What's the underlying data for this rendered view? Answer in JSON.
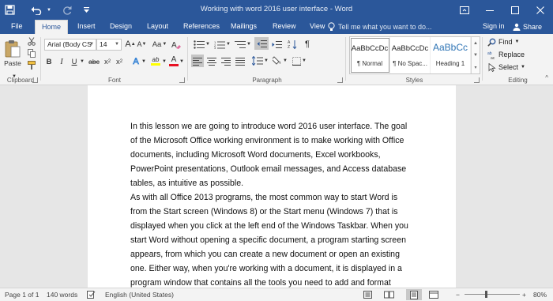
{
  "window": {
    "title": "Working with word 2016 user interface - Word"
  },
  "tabs": [
    "File",
    "Home",
    "Insert",
    "Design",
    "Layout",
    "References",
    "Mailings",
    "Review",
    "View"
  ],
  "active_tab": "Home",
  "tell_me": "Tell me what you want to do...",
  "account": {
    "signin": "Sign in",
    "share": "Share"
  },
  "ribbon": {
    "clipboard": {
      "label": "Clipboard",
      "paste": "Paste"
    },
    "font": {
      "label": "Font",
      "font_name": "Arial (Body CS",
      "font_size": "14",
      "grow_glyph": "A",
      "shrink_glyph": "A",
      "case_glyph": "Aa",
      "bold": "B",
      "italic": "I",
      "underline": "U",
      "strike": "abc",
      "subscript": "x",
      "subscript_mark": "2",
      "superscript": "x",
      "superscript_mark": "2",
      "effects_glyph": "A",
      "highlight_glyph": "ab",
      "color_glyph": "A",
      "highlight_color": "#ffff00",
      "font_color": "#e81123"
    },
    "paragraph": {
      "label": "Paragraph",
      "pilcrow": "¶"
    },
    "styles": {
      "label": "Styles",
      "items": [
        {
          "sample": "AaBbCcDc",
          "name": "¶ Normal"
        },
        {
          "sample": "AaBbCcDc",
          "name": "¶ No Spac..."
        },
        {
          "sample": "AaBbCc",
          "name": "Heading 1"
        }
      ]
    },
    "editing": {
      "label": "Editing",
      "find": "Find",
      "replace": "Replace",
      "select": "Select"
    }
  },
  "document": {
    "paragraphs": [
      "In this lesson we are going to introduce word 2016 user interface. The goal of the Microsoft Office working environment is to make working with Office documents, including Microsoft Word documents, Excel workbooks, PowerPoint presentations, Outlook email messages, and Access database tables, as intuitive as possible.",
      "As with all Office 2013 programs, the most common way to start Word is from the Start screen (Windows 8) or the Start menu (Windows 7) that is displayed when you click at the left end of the Windows Taskbar. When you start Word without opening a specific document, a program starting screen appears, from which you can create a new document or open an existing one. Either way, when you're working with a document, it is displayed in a program window that contains all the tools you need to add and format"
    ]
  },
  "status": {
    "page": "Page 1 of 1",
    "words": "140 words",
    "language": "English (United States)",
    "zoom": "80%",
    "zoom_level": 0.8,
    "zoom_minus": "−",
    "zoom_plus": "+"
  },
  "colors": {
    "title_bar": "#2b579a",
    "ribbon_bg": "#f3f3f3",
    "canvas_bg": "#e6e6e6",
    "heading_style": "#2e74b5"
  }
}
